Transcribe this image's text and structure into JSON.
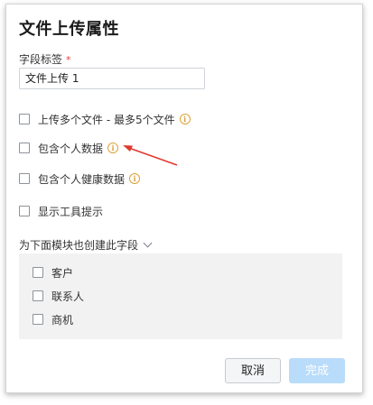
{
  "dialog": {
    "title": "文件上传属性",
    "field_label": "字段标签",
    "required_mark": "*",
    "field_value": "文件上传 1",
    "options": [
      {
        "label": "上传多个文件 - 最多5个文件",
        "info": true
      },
      {
        "label": "包含个人数据",
        "info": true
      },
      {
        "label": "包含个人健康数据",
        "info": true
      },
      {
        "label": "显示工具提示",
        "info": false
      }
    ],
    "info_glyph": "i",
    "modules_toggle": "为下面模块也创建此字段",
    "modules": [
      "客户",
      "联系人",
      "商机"
    ],
    "cancel_label": "取消",
    "done_label": "完成"
  },
  "colors": {
    "accent_disabled": "#b9dcfa",
    "info": "#d9a23a",
    "required": "#e0413c",
    "annotation_arrow": "#e03a2f"
  }
}
